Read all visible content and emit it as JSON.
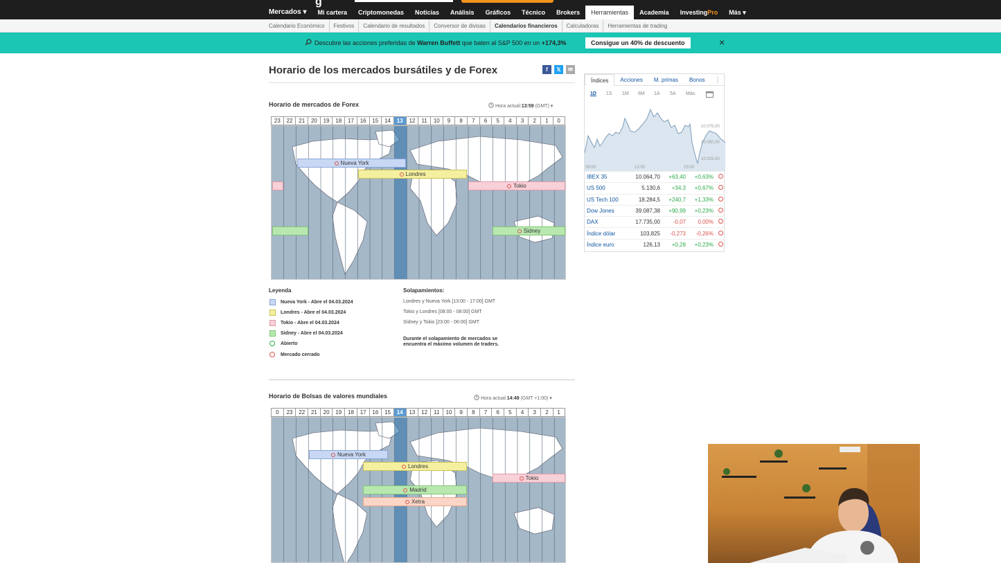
{
  "nav": {
    "logo_fragment": "g",
    "items": [
      "Mercados ▾",
      "Mi cartera",
      "Criptomonedas",
      "Noticias",
      "Análisis",
      "Gráficos",
      "Técnico",
      "Brokers",
      "Herramientas",
      "Academia",
      "InvestingPro",
      "Más ▾"
    ],
    "investing_part": "Investing",
    "pro_part": "Pro"
  },
  "subnav": {
    "items": [
      "Calendario Económico",
      "Festivos",
      "Calendario de resultados",
      "Conversor de divisas",
      "Calendarios financieros",
      "Calculadoras",
      "Herramientas de trading"
    ]
  },
  "promo": {
    "icon": "search-icon",
    "text_before": "Descubre las acciones preferidas de ",
    "name": "Warren Buffett",
    "text_middle": " que baten al S&P 500 en un ",
    "pct": "+174,3%",
    "cta": "Consigue un 40% de descuento",
    "close": "×"
  },
  "page": {
    "title": "Horario de los mercados bursátiles y de Forex",
    "share": [
      "f",
      "𝕏",
      "✉"
    ]
  },
  "forex": {
    "title": "Horario de mercados de Forex",
    "clock_label": "Hora actual:",
    "clock_time": "13:59",
    "clock_tz": "(GMT) ▾",
    "hours": [
      "23",
      "22",
      "21",
      "20",
      "19",
      "18",
      "17",
      "16",
      "15",
      "14",
      "13",
      "12",
      "11",
      "10",
      "9",
      "8",
      "7",
      "6",
      "5",
      "4",
      "3",
      "2",
      "1",
      "0"
    ],
    "current_hour": "13",
    "markets": {
      "ny": "Nueva York",
      "ld": "Londres",
      "tk": "Tokio",
      "sd": "Sidney"
    }
  },
  "legend": {
    "title": "Leyenda",
    "items": [
      "Nueva York - Abre el 04.03.2024",
      "Londres - Abre el 04.03.2024",
      "Tokio - Abre el 04.03.2024",
      "Sidney - Abre el 04.03.2024",
      "Abierto",
      "Mercado cerrado"
    ],
    "colors": {
      "ny": "#c8d8f4",
      "ld": "#f5f0a0",
      "tk": "#f8d0d8",
      "sd": "#b8e8b0",
      "open": "#2daa48",
      "closed": "#d9534f"
    }
  },
  "overlaps": {
    "title": "Solapamientos:",
    "items": [
      "Londres y Nueva York [13:00 - 17:00] GMT",
      "Tokio y Londres [08:00 - 08:00] GMT",
      "Sídney y Tokio [23:00 - 06:00] GMT"
    ],
    "note": "Durante el solapamiento de mercados se encuentra el máximo volumen de traders."
  },
  "stocks": {
    "title": "Horario de Bolsas de valores mundiales",
    "clock_label": "Hora actual:",
    "clock_time": "14:49",
    "clock_tz": "(GMT +1:00) ▾",
    "hours": [
      "0",
      "23",
      "22",
      "21",
      "20",
      "19",
      "18",
      "17",
      "16",
      "15",
      "14",
      "13",
      "12",
      "11",
      "10",
      "9",
      "8",
      "7",
      "6",
      "5",
      "4",
      "3",
      "2",
      "1"
    ],
    "current_hour": "14",
    "markets": {
      "ny": "Nueva York",
      "ld": "Londres",
      "tk": "Tokio",
      "md": "Madrid",
      "xt": "Xetra"
    }
  },
  "widget": {
    "tabs": [
      "Índices",
      "Acciones",
      "M. primas",
      "Bonos"
    ],
    "more": "⋮",
    "periods": [
      "1D",
      "1S",
      "1M",
      "6M",
      "1A",
      "5A",
      "Máx."
    ],
    "chart_labels": {
      "x": [
        "09:00",
        "12:00",
        "15:00"
      ],
      "y": [
        "10.075,00",
        "10.050,00",
        "10.025,00"
      ]
    },
    "rows": [
      {
        "name": "IBEX 35",
        "value": "10.064,70",
        "change": "+63,40",
        "pct": "+0,63%",
        "dir": "pos"
      },
      {
        "name": "US 500",
        "value": "5.130,6",
        "change": "+34,3",
        "pct": "+0,67%",
        "dir": "pos"
      },
      {
        "name": "US Tech 100",
        "value": "18.284,5",
        "change": "+240,7",
        "pct": "+1,33%",
        "dir": "pos"
      },
      {
        "name": "Dow Jones",
        "value": "39.087,38",
        "change": "+90,99",
        "pct": "+0,23%",
        "dir": "pos"
      },
      {
        "name": "DAX",
        "value": "17.735,00",
        "change": "-0,07",
        "pct": "0,00%",
        "dir": "neg"
      },
      {
        "name": "Índice dólar",
        "value": "103,825",
        "change": "-0,273",
        "pct": "-0,26%",
        "dir": "neg"
      },
      {
        "name": "Índice euro",
        "value": "126,13",
        "change": "+0,28",
        "pct": "+0,23%",
        "dir": "pos"
      }
    ]
  }
}
